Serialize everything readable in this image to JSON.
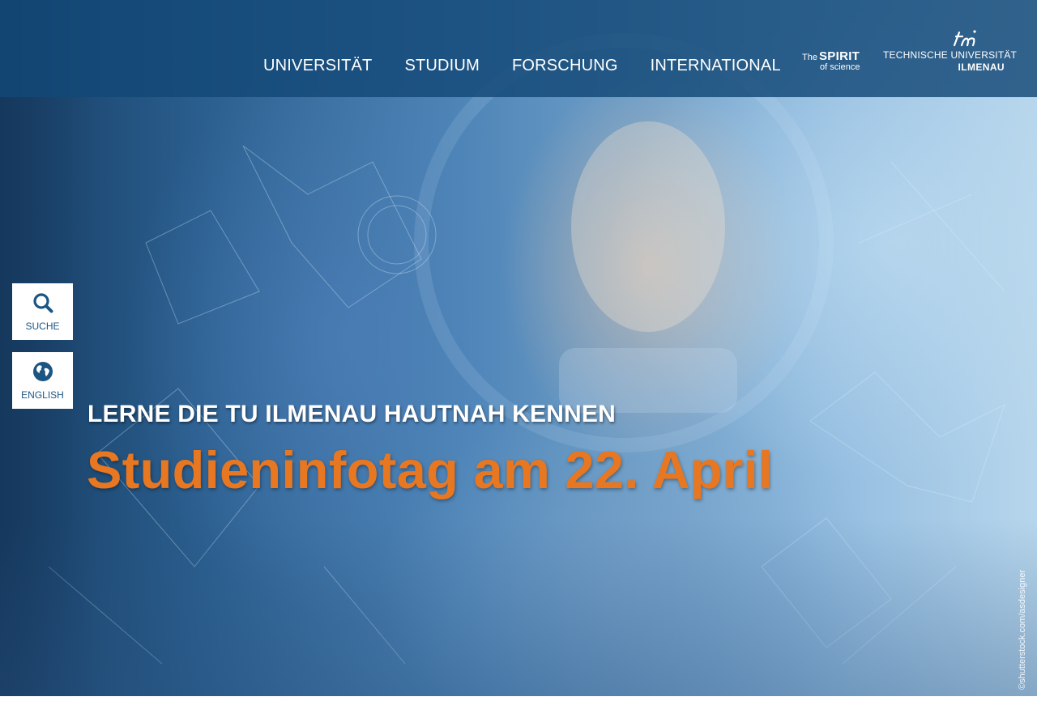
{
  "colors": {
    "header_bg": "#124876",
    "accent_orange": "#e87722",
    "button_text": "#1b5583",
    "white": "#ffffff"
  },
  "header": {
    "nav": [
      "UNIVERSITÄT",
      "STUDIUM",
      "FORSCHUNG",
      "INTERNATIONAL"
    ],
    "spirit_logo": {
      "the": "The",
      "spirit": "SPIRIT",
      "of_science": "of science"
    },
    "university_logo": {
      "line1": "TECHNISCHE UNIVERSITÄT",
      "line2": "ILMENAU",
      "icon": "tu-monogram-icon"
    }
  },
  "side_buttons": [
    {
      "label": "SUCHE",
      "icon": "search-icon"
    },
    {
      "label": "ENGLISH",
      "icon": "globe-icon"
    }
  ],
  "hero": {
    "kicker": "LERNE DIE TU ILMENAU HAUTNAH KENNEN",
    "headline": "Studieninfotag am 22. April",
    "image_credit": "©shutterstock.com/asdesigner"
  }
}
